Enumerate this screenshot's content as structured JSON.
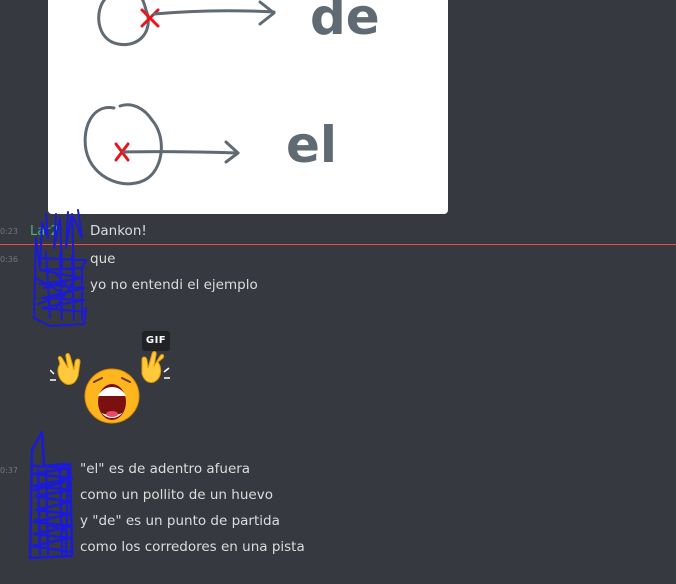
{
  "messages_top": [
    {
      "time": "0:23",
      "username": "Lar2",
      "text": "Dankon!"
    },
    {
      "time": "0:36",
      "text": "que"
    },
    {
      "text": "yo no entendi el ejemplo"
    }
  ],
  "gif": {
    "badge": "GIF",
    "icon": "crying-face-emoji"
  },
  "image": {
    "words": [
      "de",
      "el"
    ],
    "icons": [
      "circle-with-x-icon",
      "arrow-icon"
    ]
  },
  "messages_bottom": {
    "time": "0:37",
    "lines": [
      "\"el\" es de adentro afuera",
      "como un pollito de un huevo",
      "y \"de\" es un punto de partida",
      "como los corredores en una pista"
    ]
  },
  "colors": {
    "background": "#36393f",
    "text": "#dcddde",
    "username": "#43b581",
    "new_divider": "#f04747",
    "marker_x": "#e8161a",
    "scribble": "#1a1ad8"
  }
}
